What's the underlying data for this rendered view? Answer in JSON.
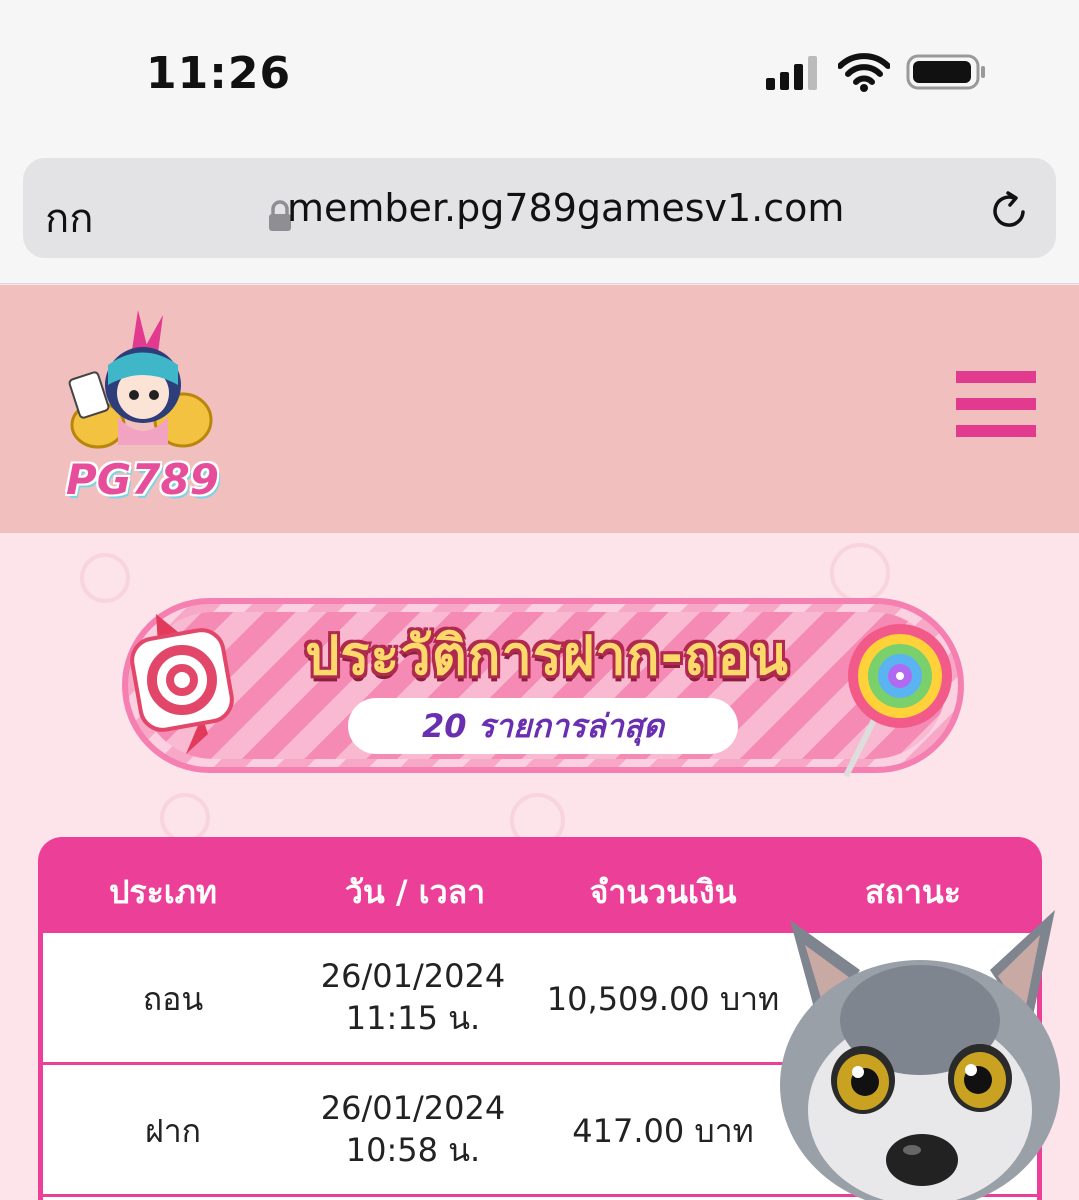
{
  "status_bar": {
    "time": "11:26",
    "signal_icon": "cellular-signal-icon",
    "wifi_icon": "wifi-icon",
    "battery_icon": "battery-icon"
  },
  "browser": {
    "text_size_label": "กก",
    "url": "member.pg789gamesv1.com",
    "lock_icon": "lock-icon",
    "reload_icon": "reload-icon"
  },
  "site_header": {
    "logo_text": "PG789",
    "menu_icon": "hamburger-menu-icon"
  },
  "banner": {
    "title": "ประวัติการฝาก-ถอน",
    "subtitle": "20 รายการล่าสุด"
  },
  "table": {
    "headers": [
      "ประเภท",
      "วัน / เวลา",
      "จำนวนเงิน",
      "สถานะ"
    ],
    "rows": [
      {
        "type": "ถอน",
        "date": "26/01/2024",
        "time": "11:15 น.",
        "amount": "10,509.00 บาท"
      },
      {
        "type": "ฝาก",
        "date": "26/01/2024",
        "time": "10:58 น.",
        "amount": "417.00 บาท"
      }
    ]
  },
  "colors": {
    "header_bg": "#f2bfbf",
    "accent_pink": "#ec3f98",
    "page_bg": "#fde3ea"
  }
}
